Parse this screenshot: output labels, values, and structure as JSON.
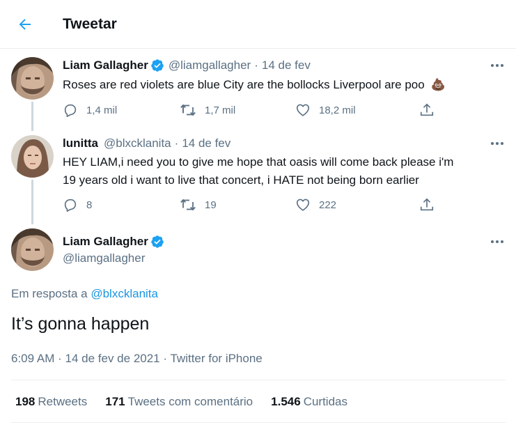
{
  "header": {
    "title": "Tweetar",
    "back_icon": "arrow-left-icon"
  },
  "colors": {
    "accent": "#1da1f2",
    "muted": "#5b7083",
    "line": "#ced8de",
    "verified": "#1da1f2"
  },
  "tweets": [
    {
      "name": "Liam Gallagher",
      "verified": true,
      "handle": "@liamgallagher",
      "date": "14 de fev",
      "text": "Roses are red violets are blue City are the bollocks Liverpool are poo",
      "emoji": "💩",
      "replies": "1,4 mil",
      "retweets": "1,7 mil",
      "likes": "18,2 mil"
    },
    {
      "name": "lunitta",
      "handle": "@blxcklanita",
      "date": "14 de fev",
      "text_line1": "HEY LIAM,i need you to give me hope that oasis will come back please i'm",
      "text_line2": "19 years old i want to live that concert, i HATE not being born earlier",
      "replies": "8",
      "retweets": "19",
      "likes": "222"
    }
  ],
  "main_tweet": {
    "name": "Liam Gallagher",
    "verified": true,
    "handle": "@liamgallagher",
    "reply_prefix": "Em resposta a",
    "reply_handle": "@blxcklanita",
    "text": "It’s gonna happen",
    "time": "6:09 AM",
    "date": "14 de fev de 2021",
    "source": "Twitter for iPhone",
    "dot": "·",
    "stats": {
      "retweets_count": "198",
      "retweets_label": "Retweets",
      "quotes_count": "171",
      "quotes_label": "Tweets com comentário",
      "likes_count": "1.546",
      "likes_label": "Curtidas"
    }
  }
}
